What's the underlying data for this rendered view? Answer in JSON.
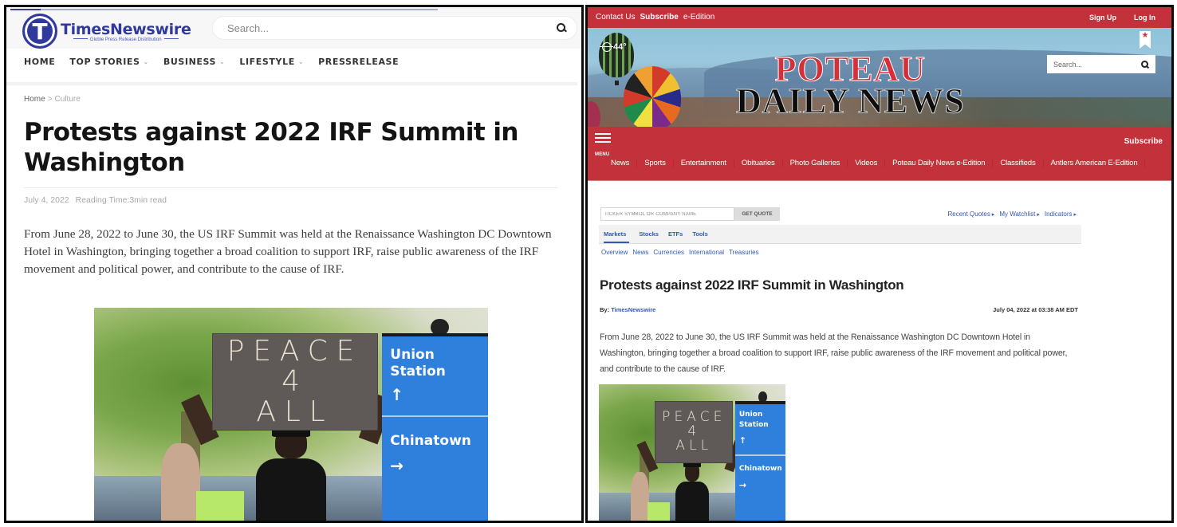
{
  "left_site": {
    "logo": {
      "letter": "T",
      "name": "TimesNewswire",
      "tagline": "Globle Press Release Distribution"
    },
    "reading_progress": 0.07,
    "search": {
      "placeholder": "Search..."
    },
    "nav": [
      {
        "label": "HOME",
        "dropdown": false
      },
      {
        "label": "TOP STORIES",
        "dropdown": true
      },
      {
        "label": "BUSINESS",
        "dropdown": true
      },
      {
        "label": "LIFESTYLE",
        "dropdown": true
      },
      {
        "label": "PRESSRELEASE",
        "dropdown": false
      }
    ],
    "chevron": "⌄",
    "breadcrumb": {
      "home": "Home",
      "separator": ">",
      "current": "Culture"
    },
    "title": "Protests against 2022 IRF Summit in Washington",
    "meta": {
      "date": "July 4, 2022",
      "reading_time": "Reading Time:3min read"
    },
    "body": "From June 28, 2022 to June 30, the US IRF Summit was held at the Renaissance Washington DC Downtown Hotel in Washington, bringing together a broad coalition to support IRF, raise public awareness of the IRF movement and political power, and contribute to the cause of IRF.",
    "photo": {
      "sign_lines": [
        "PEACE",
        "4",
        "ALL"
      ],
      "metro_sign": {
        "line1": "Union",
        "line2": "Station",
        "arrow1": "↑",
        "line3": "Chinatown",
        "arrow2": "→"
      }
    }
  },
  "right_site": {
    "top_links": {
      "contact": "Contact Us",
      "subscribe": "Subscribe",
      "eedition": "e-Edition",
      "signup": "Sign Up",
      "login": "Log In"
    },
    "weather": {
      "temperature": "44°"
    },
    "masthead": {
      "line1": "POTEAU",
      "line2": "DAILY NEWS"
    },
    "bookmark_star": "★",
    "search": {
      "placeholder": "Search..."
    },
    "menu_label": "MENU",
    "subscribe_button": "Subscribe",
    "nav": [
      "News",
      "Sports",
      "Entertainment",
      "Obituaries",
      "Photo Galleries",
      "Videos",
      "Poteau Daily News e-Edition",
      "Classifieds",
      "Antlers American E-Edition"
    ],
    "quote": {
      "placeholder": "TICKER SYMBOL OR COMPANY NAME",
      "button": "GET QUOTE",
      "links": [
        "Recent Quotes",
        "My Watchlist",
        "Indicators"
      ]
    },
    "market_tabs": [
      "Markets",
      "Stocks",
      "ETFs",
      "Tools"
    ],
    "market_subtabs": [
      "Overview",
      "News",
      "Currencies",
      "International",
      "Treasuries"
    ],
    "article": {
      "title": "Protests against 2022 IRF Summit in Washington",
      "by_label": "By:",
      "author": "TimesNewswire",
      "date": "July 04, 2022 at 03:38 AM EDT",
      "body": "From June 28, 2022 to June 30, the US IRF Summit was held at the Renaissance Washington DC Downtown Hotel in Washington, bringing together a broad coalition to support IRF, raise public awareness of the IRF movement and political power, and contribute to the cause of IRF."
    },
    "colors": {
      "brand_red": "#c3323a",
      "link_blue": "#3059b8"
    }
  }
}
